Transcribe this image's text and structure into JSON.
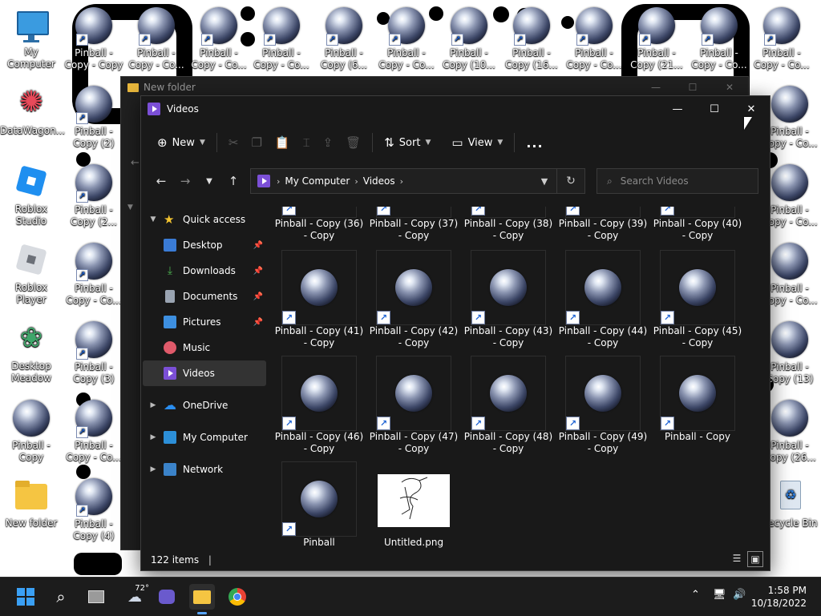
{
  "desktop": {
    "left_icons": [
      {
        "label": "My Computer"
      },
      {
        "label": "DataWagon..."
      },
      {
        "label": "Roblox Studio"
      },
      {
        "label": "Roblox Player"
      },
      {
        "label": "Desktop Meadow"
      },
      {
        "label": "Pinball - Copy"
      },
      {
        "label": "New folder"
      }
    ],
    "col2_icons": [
      {
        "label": "Pinball - Copy - Copy"
      },
      {
        "label": "Pinball - Copy (2)"
      },
      {
        "label": "Pinball - Copy (2..."
      },
      {
        "label": "Pinball - Copy - Co..."
      },
      {
        "label": "Pinball - Copy (3)"
      },
      {
        "label": "Pinball - Copy - Co..."
      },
      {
        "label": "Pinball - Copy (4)"
      }
    ],
    "top_icons": [
      {
        "label": "Pinball - Copy - Co..."
      },
      {
        "label": "Pinball - Copy - Co..."
      },
      {
        "label": "Pinball - Copy - Co..."
      },
      {
        "label": "Pinball - Copy (6..."
      },
      {
        "label": "Pinball - Copy - Co..."
      },
      {
        "label": "Pinball - Copy (10..."
      },
      {
        "label": "Pinball - Copy (16..."
      },
      {
        "label": "Pinball - Copy - Co..."
      },
      {
        "label": "Pinball - Copy (21..."
      },
      {
        "label": "Pinball - Copy - Co..."
      },
      {
        "label": "Pinball - Copy - Co..."
      }
    ],
    "right_icons": [
      {
        "label": "Pinball - Copy - Co..."
      },
      {
        "label": "Pinball - Copy - Co..."
      },
      {
        "label": "Pinball - Copy - Co..."
      },
      {
        "label": "Pinball - Copy - Co..."
      },
      {
        "label": "Pinball - Copy (13)"
      },
      {
        "label": "Pinball - Copy (26..."
      }
    ],
    "recycle_label": "Recycle Bin"
  },
  "back_window": {
    "title": "New folder"
  },
  "window": {
    "title": "Videos",
    "toolbar": {
      "new_label": "New",
      "sort_label": "Sort",
      "view_label": "View",
      "more_label": "..."
    },
    "address": {
      "crumbs": [
        "My Computer",
        "Videos"
      ]
    },
    "search_placeholder": "Search Videos",
    "nav": {
      "quick_access": "Quick access",
      "pinned": [
        {
          "label": "Desktop",
          "color": "#3a7bd5"
        },
        {
          "label": "Downloads",
          "color": "#4caf50"
        },
        {
          "label": "Documents",
          "color": "#9aa4b2"
        },
        {
          "label": "Pictures",
          "color": "#3d8fe0"
        },
        {
          "label": "Music",
          "color": "#e05a6a"
        },
        {
          "label": "Videos",
          "color": "#7b4fd6"
        }
      ],
      "onedrive": "OneDrive",
      "my_computer": "My Computer",
      "network": "Network"
    },
    "files": [
      {
        "name": "Pinball - Copy (36) - Copy"
      },
      {
        "name": "Pinball - Copy (37) - Copy"
      },
      {
        "name": "Pinball - Copy (38) - Copy"
      },
      {
        "name": "Pinball - Copy (39) - Copy"
      },
      {
        "name": "Pinball - Copy (40) - Copy"
      },
      {
        "name": "Pinball - Copy (41) - Copy"
      },
      {
        "name": "Pinball - Copy (42) - Copy"
      },
      {
        "name": "Pinball - Copy (43) - Copy"
      },
      {
        "name": "Pinball - Copy (44) - Copy"
      },
      {
        "name": "Pinball - Copy (45) - Copy"
      },
      {
        "name": "Pinball - Copy (46) - Copy"
      },
      {
        "name": "Pinball - Copy (47) - Copy"
      },
      {
        "name": "Pinball - Copy (48) - Copy"
      },
      {
        "name": "Pinball - Copy (49) - Copy"
      },
      {
        "name": "Pinball - Copy"
      },
      {
        "name": "Pinball"
      },
      {
        "name": "Untitled.png"
      }
    ],
    "status": {
      "items": "122 items"
    }
  },
  "taskbar": {
    "weather": "72°",
    "time": "1:58 PM",
    "date": "10/18/2022"
  }
}
